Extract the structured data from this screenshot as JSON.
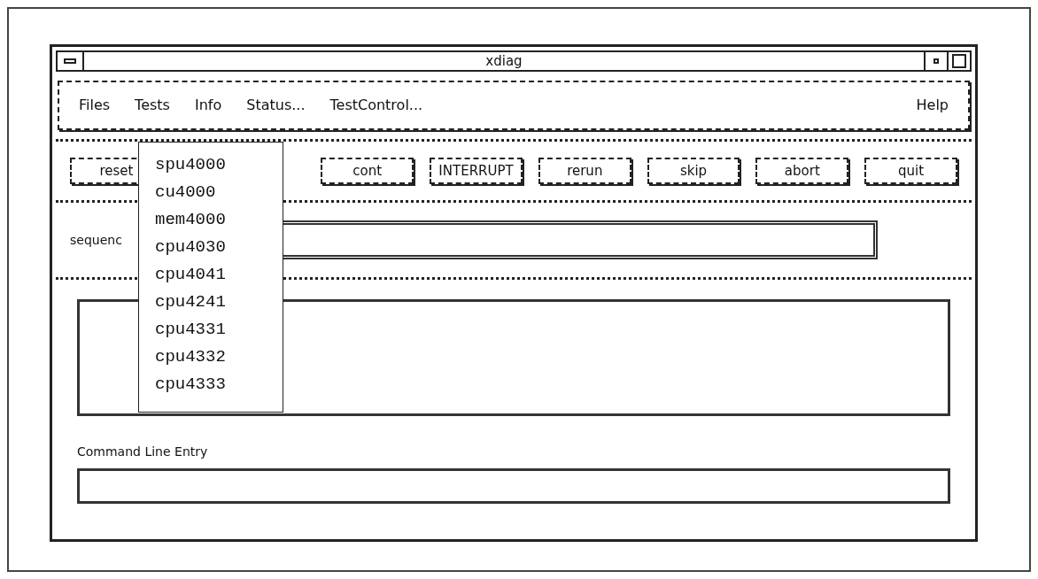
{
  "window": {
    "title": "xdiag"
  },
  "menu_bar": [
    {
      "label": "Files"
    },
    {
      "label": "Tests"
    },
    {
      "label": "Info"
    },
    {
      "label": "Status..."
    },
    {
      "label": "TestControl..."
    },
    {
      "label": "Help"
    }
  ],
  "tests_menu": {
    "open": true,
    "items": [
      "spu4000",
      "cu4000",
      "mem4000",
      "cpu4030",
      "cpu4041",
      "cpu4241",
      "cpu4331",
      "cpu4332",
      "cpu4333"
    ]
  },
  "buttons": [
    "reset",
    "cont",
    "INTERRUPT",
    "rerun",
    "skip",
    "abort",
    "quit"
  ],
  "sequence": {
    "label": "sequenc"
  },
  "command_line": {
    "label": "Command Line Entry"
  }
}
